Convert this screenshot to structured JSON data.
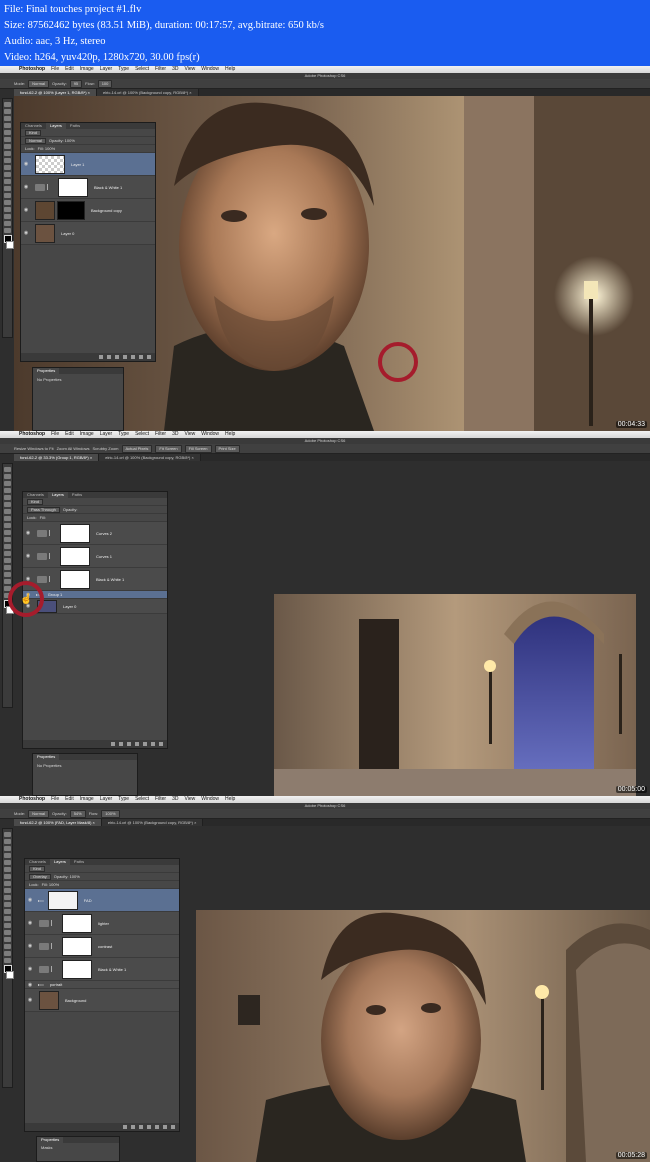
{
  "info": {
    "file": "File: Final touches project #1.flv",
    "size": "Size: 87562462 bytes (83.51 MiB), duration: 00:17:57, avg.bitrate: 650 kb/s",
    "audio": "Audio: aac, 3 Hz, stereo",
    "video": "Video: h264, yuv420p, 1280x720, 30.00 fps(r)"
  },
  "menu": {
    "app": "Photoshop",
    "items": [
      "File",
      "Edit",
      "Image",
      "Layer",
      "Type",
      "Select",
      "Filter",
      "3D",
      "View",
      "Window",
      "Help"
    ]
  },
  "window_title": "Adobe Photoshop CS6",
  "frames": [
    {
      "timestamp": "00:04:33",
      "options": {
        "mode_label": "Mode:",
        "mode": "Normal",
        "opacity_label": "Opacity:",
        "opacity": "95",
        "flow_label": "Flow:",
        "flow": "100"
      },
      "tabs": [
        "fond-62-2 @ 100% (Layer 1, RGB/8*) ×",
        "elric-14.crl @ 100% (Background copy, RGB/8*) ×"
      ],
      "panel_tabs": [
        "Channels",
        "Layers",
        "Paths"
      ],
      "panel_rows": [
        "Kind",
        "Normal",
        "Opacity: 100%",
        "Lock:",
        "Fill: 100%"
      ],
      "layers": [
        "Layer 1",
        "Black & White 1",
        "Background copy",
        "Layer 0"
      ],
      "properties": {
        "title": "Properties",
        "text": "No Properties"
      }
    },
    {
      "timestamp": "00:05:00",
      "options": {
        "resize": "Resize Windows to Fit",
        "zoom_all": "Zoom All Windows",
        "scrubby": "Scrubby Zoom",
        "buttons": [
          "Actual Pixels",
          "Fit Screen",
          "Fill Screen",
          "Print Size"
        ]
      },
      "tabs": [
        "fond-62-2 @ 33.3% (Group 1, RGB/8*) ×",
        "elric-14.crl @ 100% (Background copy, RGB/8*) ×"
      ],
      "panel_tabs": [
        "Channels",
        "Layers",
        "Paths"
      ],
      "panel_rows": [
        "Kind",
        "Pass Through",
        "Opacity:",
        "Lock:",
        "Fill:"
      ],
      "layers": [
        "Curves 2",
        "Curves 1",
        "Black & White 1",
        "Group 1",
        "Layer 0"
      ],
      "properties": {
        "title": "Properties",
        "text": "No Properties"
      }
    },
    {
      "timestamp": "00:05:28",
      "options": {
        "mode_label": "Mode:",
        "mode": "Normal",
        "opacity_label": "Opacity:",
        "opacity": "54%",
        "flow_label": "Flow:",
        "flow": "100%"
      },
      "tabs": [
        "fond-62-2 @ 100% (FAD, Layer Mask/8) ×",
        "elric-14.crl @ 100% (Background copy, RGB/8*) ×"
      ],
      "panel_tabs": [
        "Channels",
        "Layers",
        "Paths"
      ],
      "panel_rows": [
        "Kind",
        "Overlay",
        "Opacity: 100%",
        "Lock:",
        "Fill: 100%"
      ],
      "layers": [
        "FAD",
        "lighter",
        "contrast",
        "Black & White 1",
        "portrait",
        "Background"
      ],
      "properties": {
        "title": "Properties",
        "text": "Masks"
      }
    }
  ]
}
